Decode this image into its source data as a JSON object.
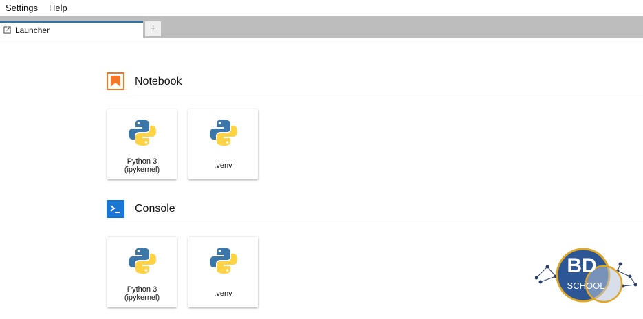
{
  "menu": {
    "items": [
      "Settings",
      "Help"
    ]
  },
  "tabs": {
    "active_label": "Launcher",
    "add_label": "+"
  },
  "sections": {
    "notebook": {
      "title": "Notebook",
      "cards": [
        {
          "label": "Python 3\n(ipykernel)"
        },
        {
          "label": ".venv"
        }
      ]
    },
    "console": {
      "title": "Console",
      "cards": [
        {
          "label": "Python 3\n(ipykernel)"
        },
        {
          "label": ".venv"
        }
      ]
    }
  },
  "watermark": {
    "text_top": "BD",
    "text_bottom": "SCHOOL"
  },
  "colors": {
    "notebook_accent": "#f37726",
    "console_accent": "#1976d2",
    "python_blue": "#3b77a8",
    "python_yellow": "#ffd343",
    "tab_accent": "#1976d2"
  }
}
